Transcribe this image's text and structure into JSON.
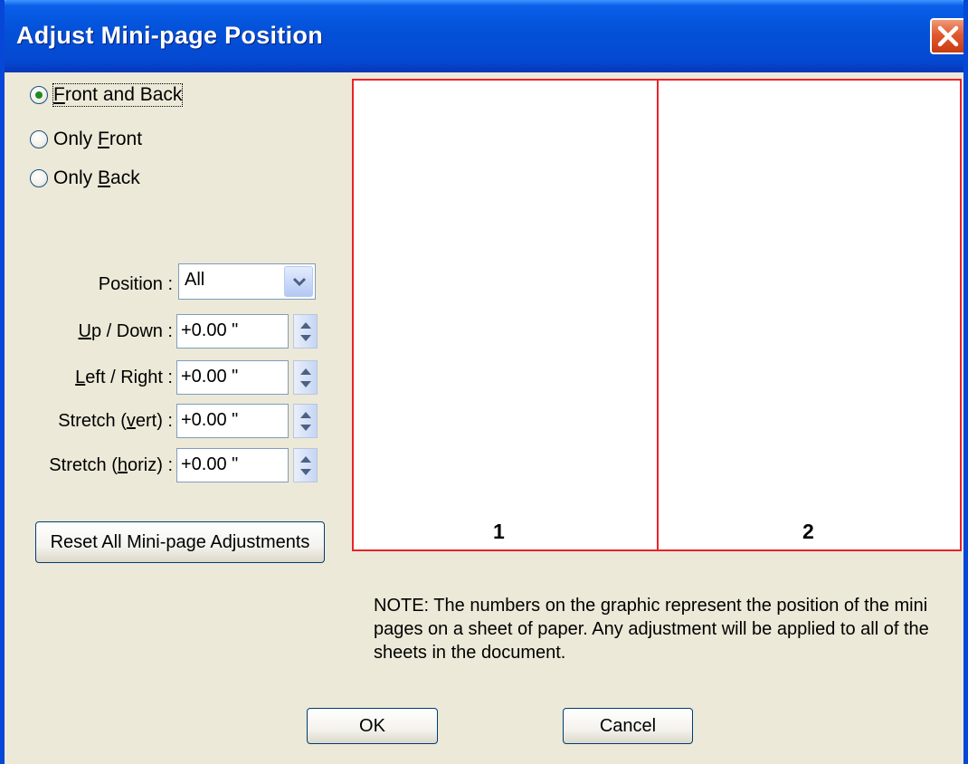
{
  "window": {
    "title": "Adjust Mini-page Position"
  },
  "side_options": [
    {
      "prefix": "",
      "mnemonic": "F",
      "suffix": "ront and Back",
      "checked": true
    },
    {
      "prefix": "Only ",
      "mnemonic": "F",
      "suffix": "ront",
      "checked": false
    },
    {
      "prefix": "Only ",
      "mnemonic": "B",
      "suffix": "ack",
      "checked": false
    }
  ],
  "position": {
    "label": "Position :",
    "value": "All"
  },
  "fields": [
    {
      "prefix": "",
      "mnemonic": "U",
      "suffix": "p / Down :",
      "value": "+0.00 \""
    },
    {
      "prefix": "",
      "mnemonic": "L",
      "suffix": "eft / Right :",
      "value": "+0.00 \""
    },
    {
      "prefix": "Stretch (",
      "mnemonic": "v",
      "suffix": "ert) :",
      "value": "+0.00 \""
    },
    {
      "prefix": "Stretch (",
      "mnemonic": "h",
      "suffix": "oriz) :",
      "value": "+0.00 \""
    }
  ],
  "reset_button": "Reset All Mini-page Adjustments",
  "preview": {
    "pages": [
      "1",
      "2"
    ],
    "border_color": "#e8232c"
  },
  "note": "NOTE: The numbers on the graphic represent the position of the mini pages on a sheet of paper.  Any adjustment will be applied to all of the sheets in the document.",
  "buttons": {
    "ok": "OK",
    "cancel": "Cancel"
  },
  "colors": {
    "titlebar": "#0352d9",
    "dialog_bg": "#ece9d8",
    "close": "#e05a30"
  }
}
